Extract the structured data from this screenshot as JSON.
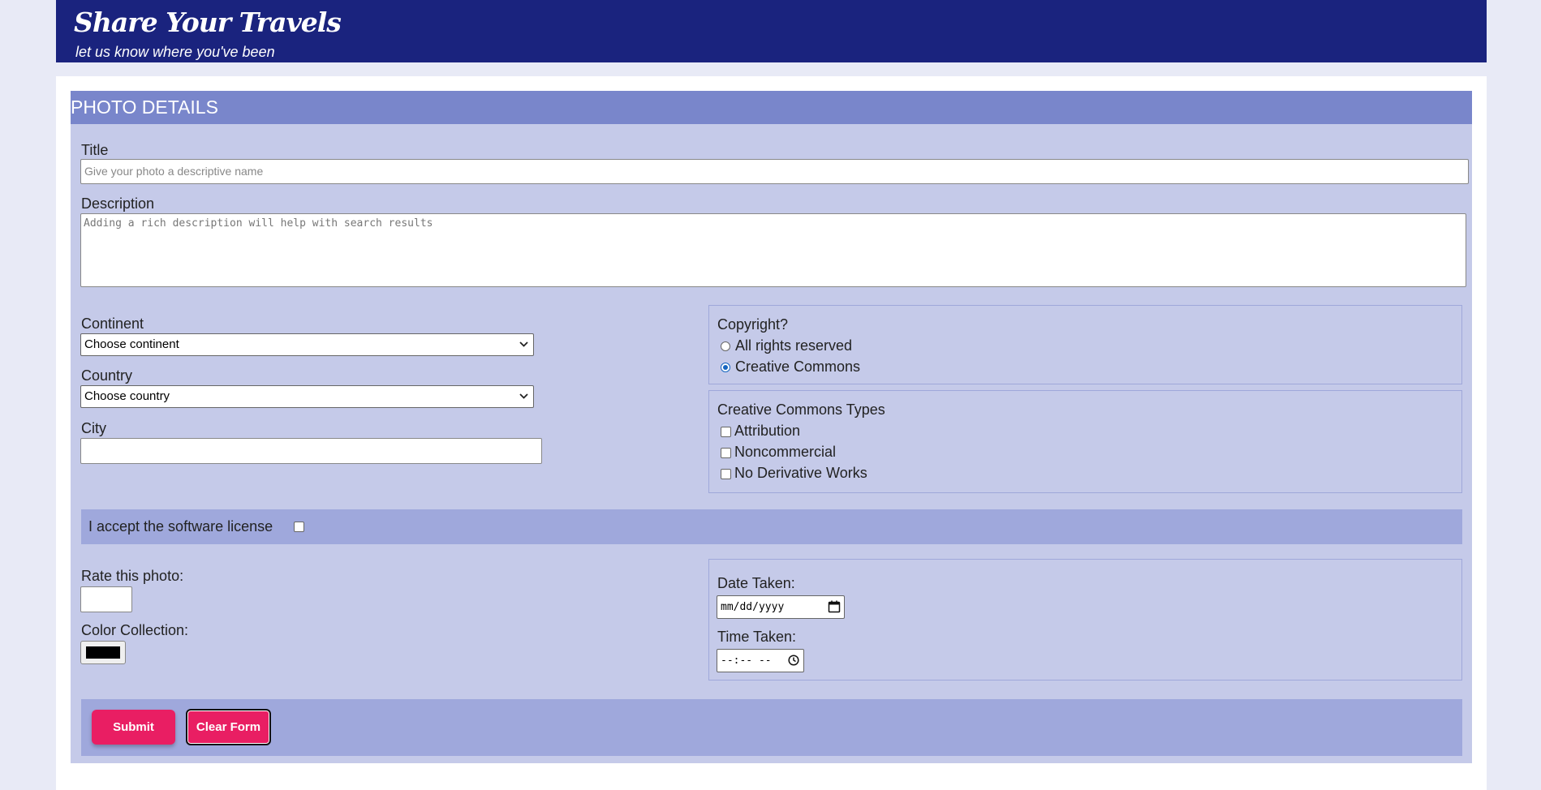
{
  "header": {
    "title": "Share Your Travels",
    "subtitle": "let us know where you've been"
  },
  "panel": {
    "heading": "PHOTO DETAILS"
  },
  "form": {
    "title_label": "Title",
    "title_placeholder": "Give your photo a descriptive name",
    "description_label": "Description",
    "description_placeholder": "Adding a rich description will help with search results",
    "continent_label": "Continent",
    "continent_value": "Choose continent",
    "country_label": "Country",
    "country_value": "Choose country",
    "city_label": "City",
    "copyright": {
      "legend": "Copyright?",
      "options": [
        "All rights reserved",
        "Creative Commons"
      ],
      "selected": "Creative Commons"
    },
    "cc_types": {
      "legend": "Creative Commons Types",
      "options": [
        "Attribution",
        "Noncommercial",
        "No Derivative Works"
      ]
    },
    "license_label": "I accept the software license",
    "rate_label": "Rate this photo:",
    "color_label": "Color Collection:",
    "color_value": "#000000",
    "date_label": "Date Taken:",
    "date_placeholder": "mm/dd/yyyy",
    "time_label": "Time Taken:",
    "time_placeholder": "--:-- --",
    "submit_label": "Submit",
    "clear_label": "Clear Form"
  },
  "colors": {
    "header_bg": "#1a237e",
    "panel_head_bg": "#7986cb",
    "panel_bg": "#c5cae9",
    "band_bg": "#9fa8dc",
    "button_bg": "#e91e63"
  },
  "icons": {
    "calendar": "calendar-icon",
    "clock": "clock-icon",
    "chevron": "chevron-down-icon"
  }
}
